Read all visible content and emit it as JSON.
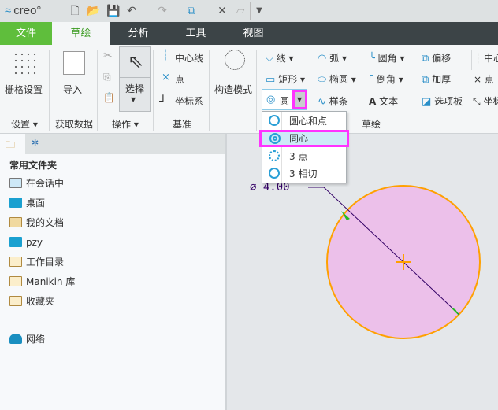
{
  "app": {
    "logo": "creo"
  },
  "quick_access": {
    "icons": [
      "new-file-icon",
      "open-folder-icon",
      "save-icon",
      "undo-icon",
      "redo-icon",
      "regenerate-icon",
      "close-window-icon",
      "windows-icon",
      "customize-icon"
    ]
  },
  "tabs": [
    {
      "label": "文件",
      "state": "file"
    },
    {
      "label": "草绘",
      "state": "active"
    },
    {
      "label": "分析"
    },
    {
      "label": "工具"
    },
    {
      "label": "视图"
    }
  ],
  "ribbon": {
    "settings": {
      "grid": "栅格设置",
      "group": "设置"
    },
    "get_data": {
      "import": "导入",
      "group": "获取数据"
    },
    "operations": {
      "select": "选择",
      "group": "操作"
    },
    "datum": {
      "centerline": "中心线",
      "point": "点",
      "csys": "坐标系",
      "group": "基准"
    },
    "construction": {
      "label": "构造模式"
    },
    "sketch": {
      "line": "线",
      "arc": "弧",
      "fillet": "圆角",
      "offset": "偏移",
      "centerline2": "中心",
      "rect": "矩形",
      "ellipse": "椭圆",
      "chamfer": "倒角",
      "thicken": "加厚",
      "point2": "点",
      "circle": "圆",
      "spline": "样条",
      "text": "文本",
      "palette": "选项板",
      "csys2": "坐标",
      "group": "草绘"
    }
  },
  "circle_menu": {
    "items": [
      {
        "label": "圆心和点"
      },
      {
        "label": "同心",
        "state": "highlighted"
      },
      {
        "label": "3 点"
      },
      {
        "label": "3 相切"
      }
    ]
  },
  "panel": {
    "header": "常用文件夹",
    "items": [
      {
        "label": "在会话中",
        "icon": "monitor-icon"
      },
      {
        "label": "桌面",
        "icon": "desktop-icon"
      },
      {
        "label": "我的文档",
        "icon": "documents-icon"
      },
      {
        "label": "pzy",
        "icon": "computer-icon"
      },
      {
        "label": "工作目录",
        "icon": "working-dir-icon"
      },
      {
        "label": "Manikin 库",
        "icon": "library-icon"
      },
      {
        "label": "收藏夹",
        "icon": "favorites-icon"
      },
      {
        "label": "网络",
        "icon": "network-icon"
      }
    ]
  },
  "canvas": {
    "dimension": "∅ 4.00",
    "colors": {
      "circle_fill": "#ecc0ea",
      "circle_stroke": "#ffa000",
      "dim": "#330066",
      "arrow": "#22bb22",
      "highlight": "#ff33ff"
    }
  }
}
